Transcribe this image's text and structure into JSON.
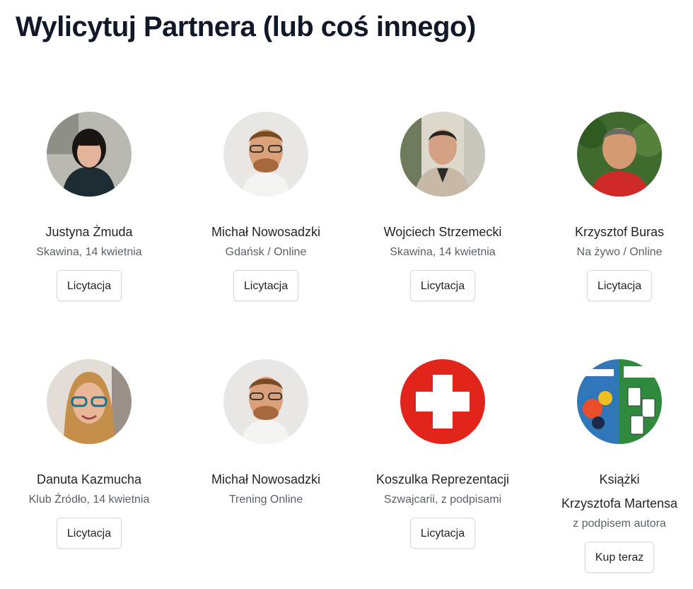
{
  "page": {
    "title": "Wylicytuj Partnera (lub coś innego)"
  },
  "cards": [
    {
      "name": "Justyna Żmuda",
      "subtitle": "Skawina, 14 kwietnia",
      "button": "Licytacja"
    },
    {
      "name": "Michał Nowosadzki",
      "subtitle": "Gdańsk / Online",
      "button": "Licytacja"
    },
    {
      "name": "Wojciech Strzemecki",
      "subtitle": "Skawina, 14 kwietnia",
      "button": "Licytacja"
    },
    {
      "name": "Krzysztof Buras",
      "subtitle": "Na żywo / Online",
      "button": "Licytacja"
    },
    {
      "name": "Danuta Kazmucha",
      "subtitle": "Klub Źródło, 14 kwietnia",
      "button": "Licytacja"
    },
    {
      "name": "Michał Nowosadzki",
      "subtitle": "Trening Online"
    },
    {
      "name": "Koszulka Reprezentacji",
      "subtitle": "Szwajcarii, z podpisami",
      "button": "Licytacja"
    },
    {
      "name": "Książki",
      "name_line2": "Krzysztofa Martensa",
      "subtitle": "z podpisem autora",
      "button": "Kup teraz"
    }
  ],
  "colors": {
    "swiss_red": "#e1251b",
    "text_dark": "#111827",
    "text_muted": "#5a6169"
  },
  "icons": [
    "swiss-cross-icon",
    "book-cover-image"
  ]
}
